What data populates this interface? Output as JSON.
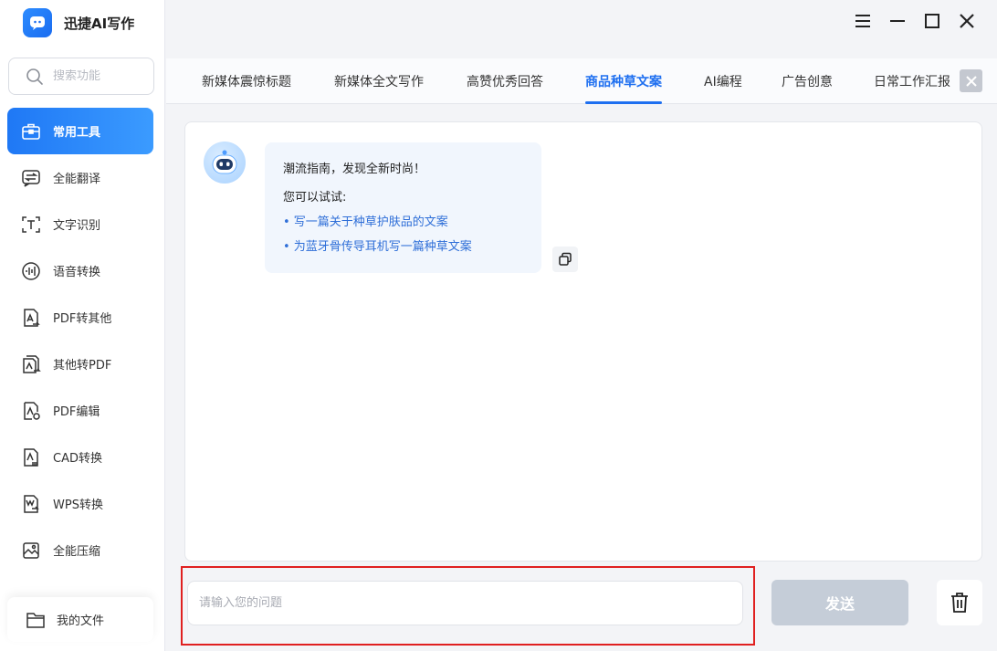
{
  "app": {
    "title": "迅捷AI写作"
  },
  "search": {
    "placeholder": "搜索功能"
  },
  "sidebar": {
    "items": [
      {
        "label": "常用工具",
        "icon": "toolbox-icon",
        "active": true
      },
      {
        "label": "全能翻译",
        "icon": "translate-icon"
      },
      {
        "label": "文字识别",
        "icon": "text-scan-icon"
      },
      {
        "label": "语音转换",
        "icon": "voice-icon"
      },
      {
        "label": "PDF转其他",
        "icon": "pdf-convert-icon"
      },
      {
        "label": "其他转PDF",
        "icon": "to-pdf-icon"
      },
      {
        "label": "PDF编辑",
        "icon": "pdf-edit-icon"
      },
      {
        "label": "CAD转换",
        "icon": "cad-icon"
      },
      {
        "label": "WPS转换",
        "icon": "wps-icon"
      },
      {
        "label": "全能压缩",
        "icon": "compress-icon"
      }
    ],
    "my_files": "我的文件"
  },
  "tabs": [
    {
      "label": "新媒体震惊标题"
    },
    {
      "label": "新媒体全文写作"
    },
    {
      "label": "高赞优秀回答"
    },
    {
      "label": "商品种草文案",
      "active": true
    },
    {
      "label": "AI编程"
    },
    {
      "label": "广告创意"
    },
    {
      "label": "日常工作汇报"
    }
  ],
  "chat": {
    "greeting": "潮流指南，发现全新时尚！",
    "try_label": "您可以试试:",
    "suggestions": [
      "• 写一篇关于种草护肤品的文案",
      "• 为蓝牙骨传导耳机写一篇种草文案"
    ]
  },
  "input": {
    "placeholder": "请输入您的问题",
    "value": ""
  },
  "send": {
    "label": "发送"
  },
  "colors": {
    "accent": "#1e6ff0",
    "highlight": "#e02020",
    "send_disabled": "#c5cdd8"
  }
}
